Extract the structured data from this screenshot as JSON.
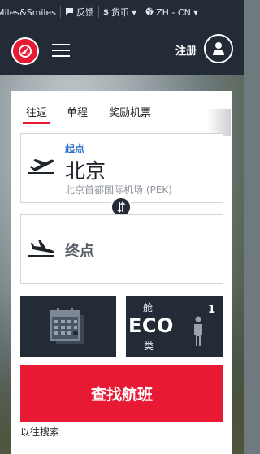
{
  "topbar": {
    "miles_label": "Miles&Smiles",
    "feedback_label": "反馈",
    "currency_label": "货币",
    "language_label": "ZH - CN"
  },
  "header": {
    "register_label": "注册"
  },
  "booking": {
    "tabs": [
      {
        "label": "往返",
        "active": true
      },
      {
        "label": "单程",
        "active": false
      },
      {
        "label": "奖励机票",
        "active": false
      }
    ],
    "from": {
      "label": "起点",
      "city": "北京",
      "airport": "北京首都国际机场 (PEK)"
    },
    "to": {
      "placeholder": "终点"
    },
    "cabin": {
      "top": "舱",
      "code": "ECO",
      "bottom": "类"
    },
    "passengers": "1",
    "search_label": "查找航班",
    "past_search_label": "以往搜索"
  },
  "colors": {
    "accent_red": "#e81932",
    "dark_navy": "#232b37",
    "link_blue": "#2a6fc7"
  },
  "icons": [
    "comment-icon",
    "dollar-icon",
    "globe-icon",
    "chevron-down-icon",
    "tk-logo-icon",
    "menu-icon",
    "user-icon",
    "takeoff-icon",
    "landing-icon",
    "swap-icon",
    "calendar-icon",
    "person-icon"
  ]
}
